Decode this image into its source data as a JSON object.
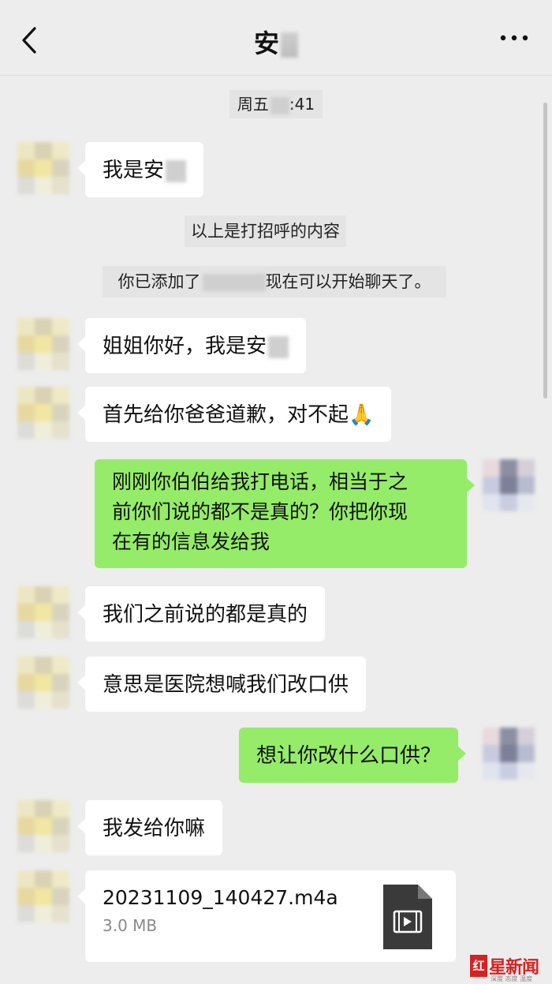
{
  "header": {
    "title": "安",
    "back_icon": "chevron-left-icon",
    "more_icon": "more-horizontal-icon"
  },
  "timestamp": "周五",
  "timestamp_tail": ":41",
  "system": {
    "greeting_note": "以上是打招呼的内容",
    "added_note_a": "你已添加了",
    "added_note_b": "现在可以开始聊天了。"
  },
  "messages": [
    {
      "side": "in",
      "text": "我是安"
    },
    {
      "side": "in",
      "text": "姐姐你好，我是安"
    },
    {
      "side": "in",
      "text": "首先给你爸爸道歉，对不起🙏"
    },
    {
      "side": "out",
      "lines": [
        "刚刚你伯伯给我打电话，相当于之",
        "前你们说的都不是真的？你把你现",
        "在有的信息发给我"
      ]
    },
    {
      "side": "in",
      "text": "我们之前说的都是真的"
    },
    {
      "side": "in",
      "text": "意思是医院想喊我们改口供"
    },
    {
      "side": "out",
      "text": "想让你改什么口供？"
    },
    {
      "side": "in",
      "text": "我发给你嘛"
    }
  ],
  "file": {
    "name": "20231109_140427.m4a",
    "size": "3.0 MB",
    "icon": "video-file-icon"
  },
  "watermark": {
    "badge": "红",
    "text": "星新闻",
    "sub": "深度 态度 温度"
  }
}
